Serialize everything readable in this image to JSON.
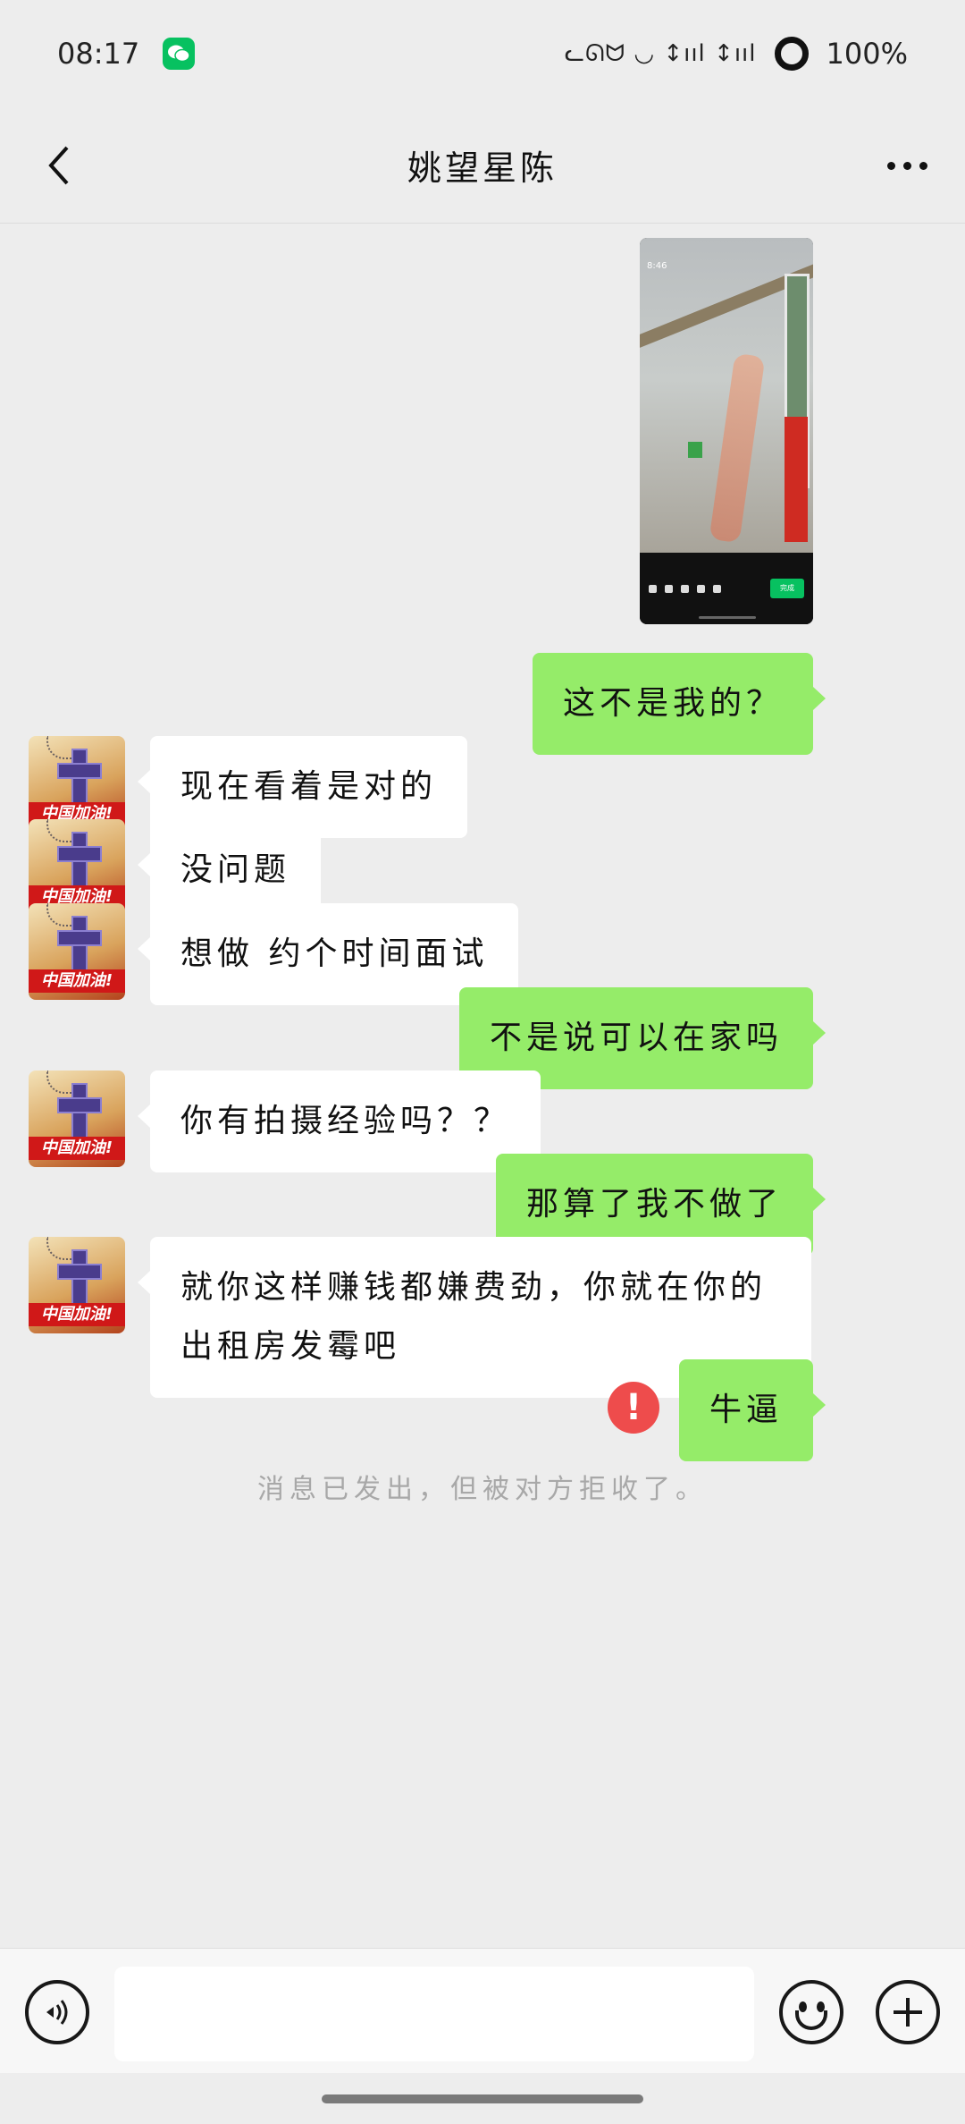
{
  "status_bar": {
    "time": "08:17",
    "indicators": "ᓚᘏᗢ ◡ ↕ııl ↕ııl",
    "battery": "100%"
  },
  "header": {
    "title": "姚望星陈"
  },
  "messages": [
    {
      "side": "out",
      "type": "image"
    },
    {
      "side": "out",
      "text": "这不是我的？"
    },
    {
      "side": "in",
      "text": "现在看着是对的"
    },
    {
      "side": "in",
      "text": "没问题"
    },
    {
      "side": "in",
      "text": "想做 约个时间面试"
    },
    {
      "side": "out",
      "text": "不是说可以在家吗"
    },
    {
      "side": "in",
      "text": "你有拍摄经验吗？？"
    },
    {
      "side": "out",
      "text": "那算了我不做了"
    },
    {
      "side": "in",
      "text": "就你这样赚钱都嫌费劲，你就在你的出租房发霉吧"
    },
    {
      "side": "out",
      "text": "牛逼",
      "failed": true
    }
  ],
  "avatar_caption": "中国加油!",
  "system_notice": "消息已发出，但被对方拒收了。",
  "input": {
    "value": ""
  },
  "colors": {
    "out_bubble": "#95ec69",
    "in_bubble": "#ffffff",
    "background": "#ededed",
    "error": "#ee4c4c"
  }
}
